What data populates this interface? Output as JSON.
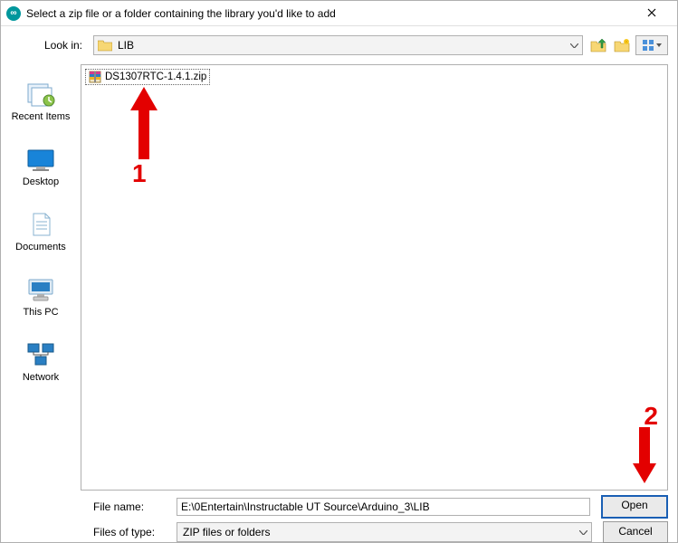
{
  "title": "Select a zip file or a folder containing the library you'd like to add",
  "lookin": {
    "label": "Look in:",
    "folder": "LIB"
  },
  "places": {
    "recent": "Recent Items",
    "desktop": "Desktop",
    "documents": "Documents",
    "thispc": "This PC",
    "network": "Network"
  },
  "files": {
    "item0": "DS1307RTC-1.4.1.zip"
  },
  "annotations": {
    "num1": "1",
    "num2": "2"
  },
  "bottom": {
    "filename_label": "File name:",
    "filename_value": "E:\\0Entertain\\Instructable UT Source\\Arduino_3\\LIB",
    "filetype_label": "Files of type:",
    "filetype_value": "ZIP files or folders",
    "open": "Open",
    "cancel": "Cancel"
  }
}
